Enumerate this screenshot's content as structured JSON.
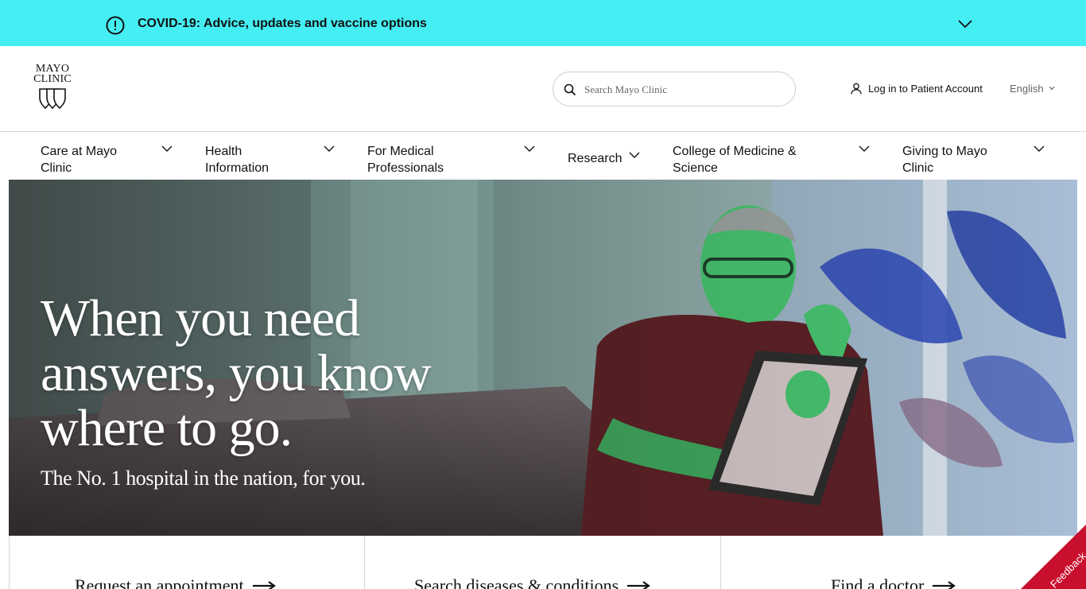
{
  "covid_banner": {
    "text": "COVID-19: Advice, updates and vaccine options",
    "background": "#44eef3",
    "icon": "alert-circle-icon",
    "toggle_icon": "chevron-down-icon"
  },
  "header": {
    "logo_line1": "MAYO",
    "logo_line2": "CLINIC",
    "search": {
      "placeholder": "Search Mayo Clinic",
      "icon": "search-icon"
    },
    "login_label": "Log in to Patient Account",
    "login_icon": "user-icon",
    "language": "English"
  },
  "nav": {
    "items": [
      {
        "label": "Care at Mayo Clinic"
      },
      {
        "label": "Health Information"
      },
      {
        "label": "For Medical Professionals"
      },
      {
        "label": "Research"
      },
      {
        "label": "College of Medicine & Science"
      },
      {
        "label": "Giving to Mayo Clinic"
      }
    ]
  },
  "hero": {
    "headline": "When you need answers, you know where to go.",
    "subheadline": "The No. 1 hospital in the nation, for you."
  },
  "quick_links": [
    {
      "label": "Request an appointment"
    },
    {
      "label": "Search diseases & conditions"
    },
    {
      "label": "Find a doctor"
    }
  ],
  "feedback": {
    "label": "Feedback",
    "color": "#c8102e"
  }
}
